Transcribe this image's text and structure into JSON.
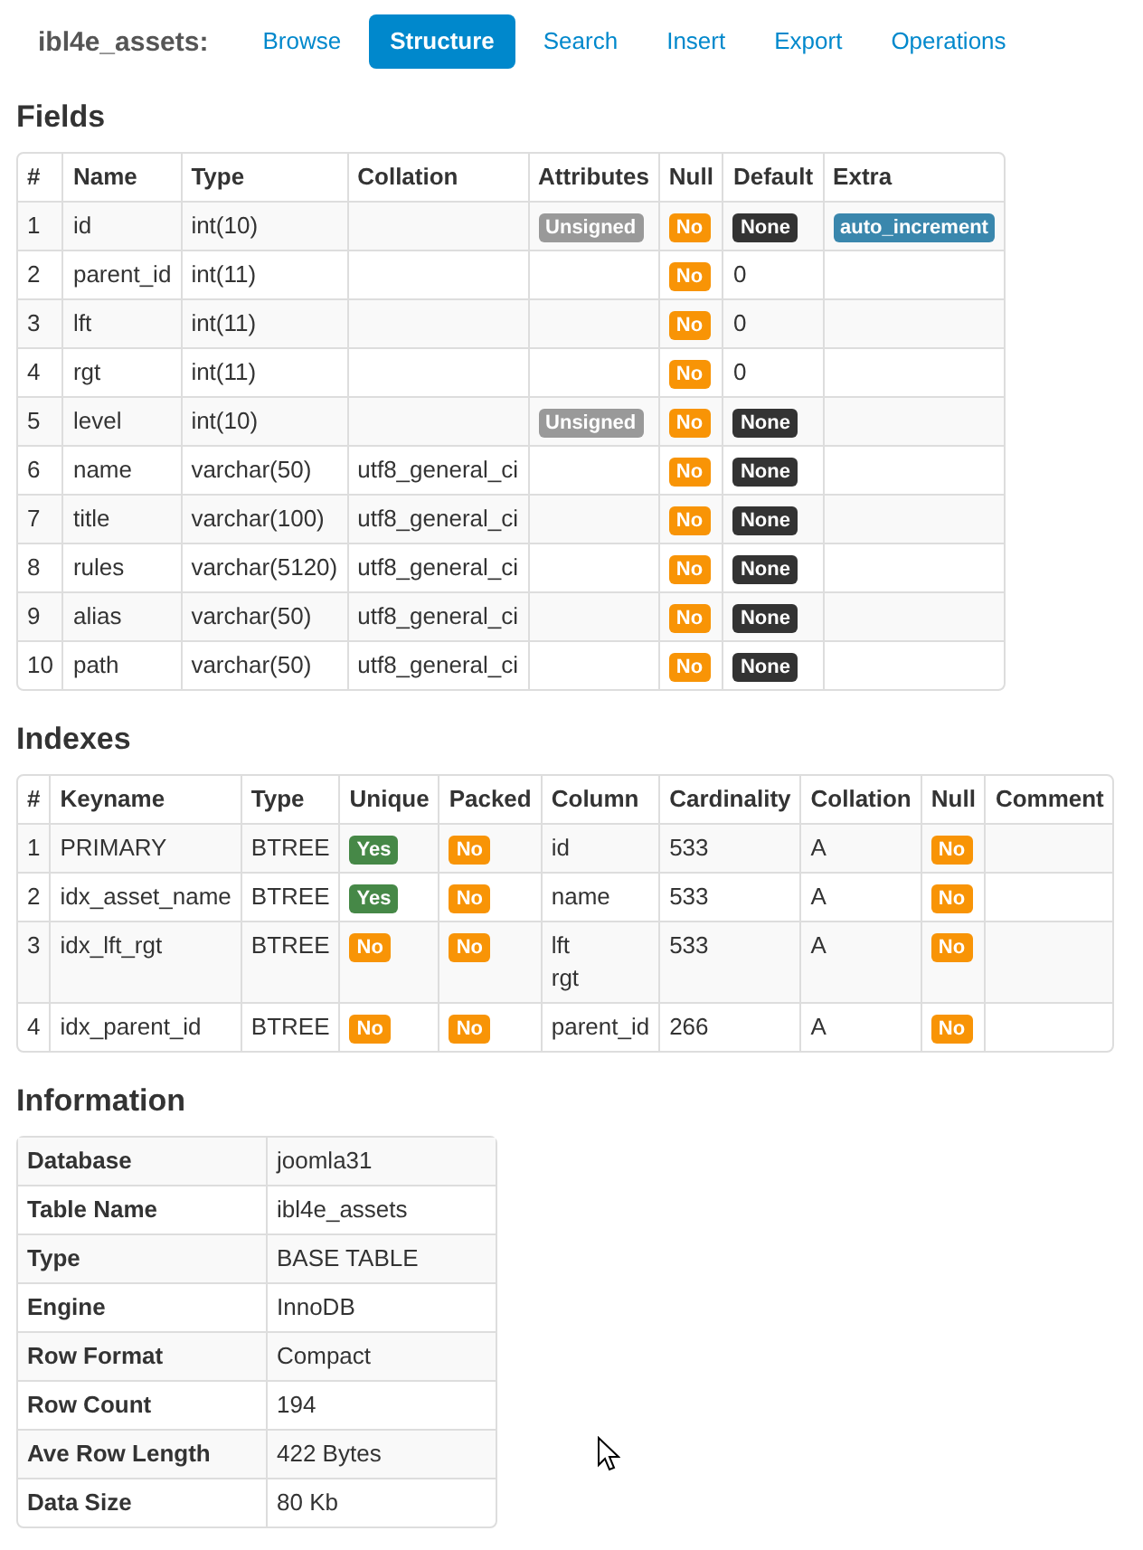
{
  "header": {
    "title": "ibl4e_assets:",
    "tabs": [
      {
        "label": "Browse",
        "selected": false
      },
      {
        "label": "Structure",
        "selected": true
      },
      {
        "label": "Search",
        "selected": false
      },
      {
        "label": "Insert",
        "selected": false
      },
      {
        "label": "Export",
        "selected": false
      },
      {
        "label": "Operations",
        "selected": false
      }
    ]
  },
  "fields": {
    "title": "Fields",
    "columns": [
      "#",
      "Name",
      "Type",
      "Collation",
      "Attributes",
      "Null",
      "Default",
      "Extra"
    ],
    "rows": [
      [
        "1",
        "id",
        "int(10)",
        null,
        {
          "badge": "Unsigned",
          "color": "#999999"
        },
        {
          "badge": "No",
          "color": "#f89406"
        },
        {
          "badge": "None",
          "color": "#333333"
        },
        {
          "badge": "auto_increment",
          "color": "#3a87ad"
        }
      ],
      [
        "2",
        "parent_id",
        "int(11)",
        null,
        null,
        {
          "badge": "No",
          "color": "#f89406"
        },
        "0",
        null
      ],
      [
        "3",
        "lft",
        "int(11)",
        null,
        null,
        {
          "badge": "No",
          "color": "#f89406"
        },
        "0",
        null
      ],
      [
        "4",
        "rgt",
        "int(11)",
        null,
        null,
        {
          "badge": "No",
          "color": "#f89406"
        },
        "0",
        null
      ],
      [
        "5",
        "level",
        "int(10)",
        null,
        {
          "badge": "Unsigned",
          "color": "#999999"
        },
        {
          "badge": "No",
          "color": "#f89406"
        },
        {
          "badge": "None",
          "color": "#333333"
        },
        null
      ],
      [
        "6",
        "name",
        "varchar(50)",
        "utf8_general_ci",
        null,
        {
          "badge": "No",
          "color": "#f89406"
        },
        {
          "badge": "None",
          "color": "#333333"
        },
        null
      ],
      [
        "7",
        "title",
        "varchar(100)",
        "utf8_general_ci",
        null,
        {
          "badge": "No",
          "color": "#f89406"
        },
        {
          "badge": "None",
          "color": "#333333"
        },
        null
      ],
      [
        "8",
        "rules",
        "varchar(5120)",
        "utf8_general_ci",
        null,
        {
          "badge": "No",
          "color": "#f89406"
        },
        {
          "badge": "None",
          "color": "#333333"
        },
        null
      ],
      [
        "9",
        "alias",
        "varchar(50)",
        "utf8_general_ci",
        null,
        {
          "badge": "No",
          "color": "#f89406"
        },
        {
          "badge": "None",
          "color": "#333333"
        },
        null
      ],
      [
        "10",
        "path",
        "varchar(50)",
        "utf8_general_ci",
        null,
        {
          "badge": "No",
          "color": "#f89406"
        },
        {
          "badge": "None",
          "color": "#333333"
        },
        null
      ]
    ]
  },
  "indexes": {
    "title": "Indexes",
    "columns": [
      "#",
      "Keyname",
      "Type",
      "Unique",
      "Packed",
      "Column",
      "Cardinality",
      "Collation",
      "Null",
      "Comment"
    ],
    "rows": [
      [
        "1",
        "PRIMARY",
        "BTREE",
        {
          "badge": "Yes",
          "color": "#468847"
        },
        {
          "badge": "No",
          "color": "#f89406"
        },
        "id",
        "533",
        "A",
        {
          "badge": "No",
          "color": "#f89406"
        },
        null
      ],
      [
        "2",
        "idx_asset_name",
        "BTREE",
        {
          "badge": "Yes",
          "color": "#468847"
        },
        {
          "badge": "No",
          "color": "#f89406"
        },
        "name",
        "533",
        "A",
        {
          "badge": "No",
          "color": "#f89406"
        },
        null
      ],
      [
        "3",
        "idx_lft_rgt",
        "BTREE",
        {
          "badge": "No",
          "color": "#f89406"
        },
        {
          "badge": "No",
          "color": "#f89406"
        },
        "lft\nrgt",
        "533",
        "A",
        {
          "badge": "No",
          "color": "#f89406"
        },
        null
      ],
      [
        "4",
        "idx_parent_id",
        "BTREE",
        {
          "badge": "No",
          "color": "#f89406"
        },
        {
          "badge": "No",
          "color": "#f89406"
        },
        "parent_id",
        "266",
        "A",
        {
          "badge": "No",
          "color": "#f89406"
        },
        null
      ]
    ]
  },
  "information": {
    "title": "Information",
    "rows": [
      {
        "label": "Database",
        "value": "joomla31"
      },
      {
        "label": "Table Name",
        "value": "ibl4e_assets"
      },
      {
        "label": "Type",
        "value": "BASE TABLE"
      },
      {
        "label": "Engine",
        "value": "InnoDB"
      },
      {
        "label": "Row Format",
        "value": "Compact"
      },
      {
        "label": "Row Count",
        "value": "194"
      },
      {
        "label": "Ave Row Length",
        "value": "422 Bytes"
      },
      {
        "label": "Data Size",
        "value": "80 Kb"
      }
    ]
  }
}
